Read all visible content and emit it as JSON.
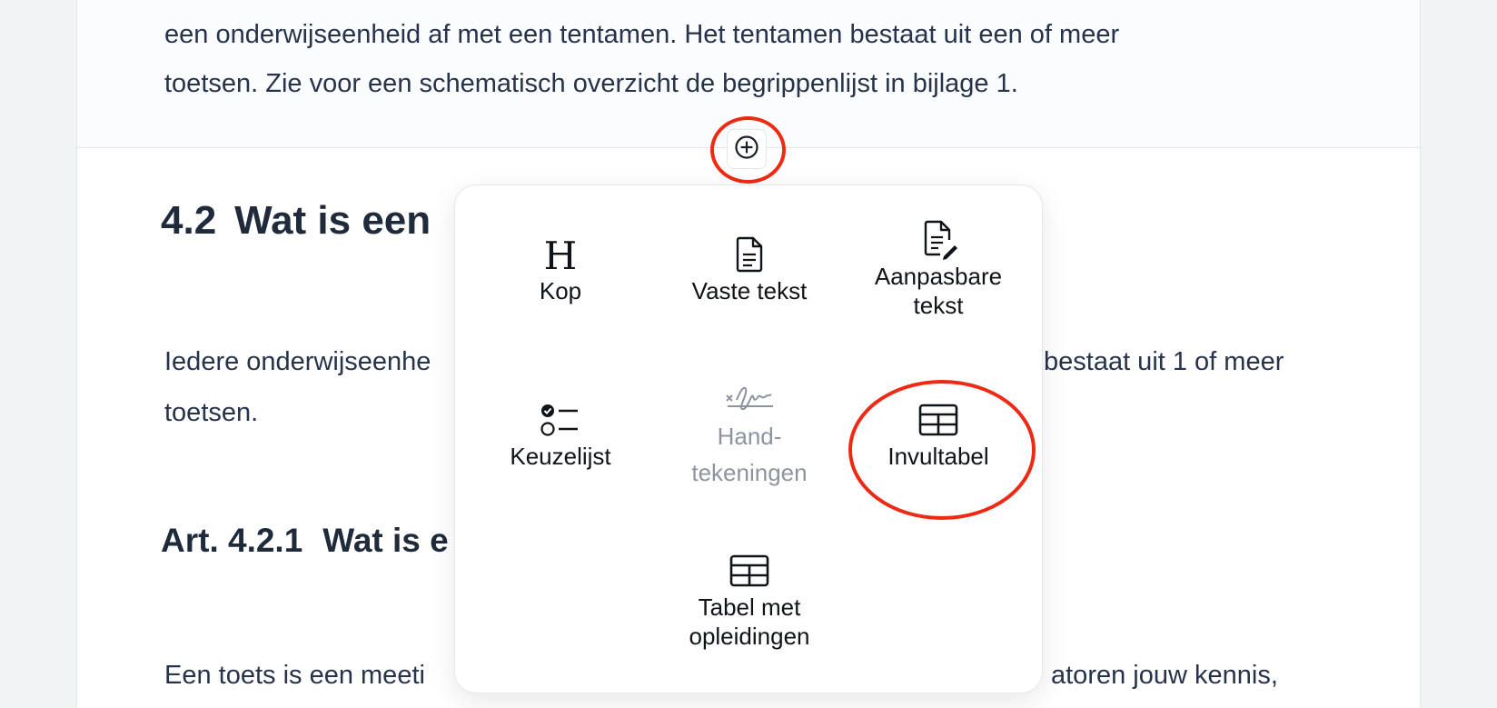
{
  "document": {
    "intro_lines": [
      "een onderwijseenheid af met een tentamen. Het tentamen bestaat uit een of meer",
      "toetsen. Zie voor een schematisch overzicht de begrippenlijst in bijlage 1."
    ],
    "section": {
      "number": "4.2",
      "title": "Wat is een"
    },
    "section_para": {
      "line1_left": "Iedere onderwijseenhe",
      "line1_right": "bestaat uit 1 of meer",
      "line2": "toetsen."
    },
    "article": {
      "number": "Art. 4.2.1",
      "title": "Wat is e"
    },
    "article_para": {
      "left": "Een toets is een meeti",
      "right": "atoren jouw kennis,"
    }
  },
  "add_button": {
    "icon": "plus-circle-icon"
  },
  "insert_menu": {
    "items": [
      {
        "id": "kop",
        "label": "Kop",
        "icon": "heading-icon"
      },
      {
        "id": "vaste-tekst",
        "label": "Vaste tekst",
        "icon": "document-icon"
      },
      {
        "id": "aanpasbare-tekst",
        "label": "Aanpasbare\ntekst",
        "icon": "document-edit-icon"
      },
      {
        "id": "keuzelijst",
        "label": "Keuzelijst",
        "icon": "checklist-icon"
      },
      {
        "id": "handtekeningen",
        "label": "Hand-\ntekeningen",
        "icon": "signature-icon",
        "disabled": true
      },
      {
        "id": "invultabel",
        "label": "Invultabel",
        "icon": "table-icon"
      },
      {
        "id": "tabel-met-opleidingen",
        "label": "Tabel met\nopleidingen",
        "icon": "table-icon"
      }
    ]
  },
  "colors": {
    "highlight_ring": "#ee2a14",
    "text": "#26334a",
    "disabled_text": "#8d949d"
  }
}
